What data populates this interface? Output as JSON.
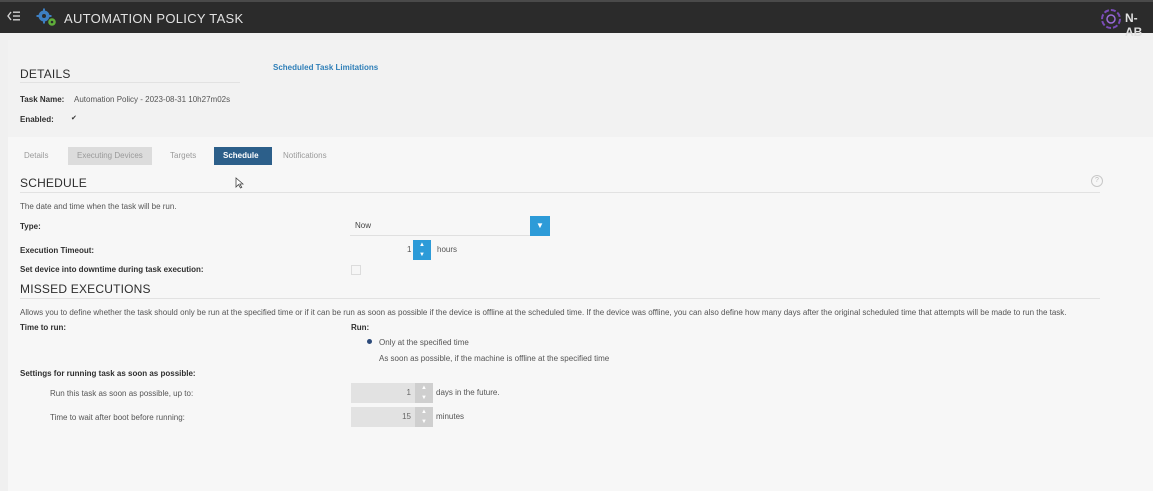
{
  "header": {
    "title": "AUTOMATION POLICY TASK",
    "brand": "N-AB",
    "menu_icon": "⋲"
  },
  "details": {
    "heading": "DETAILS",
    "limitations_link": "Scheduled Task Limitations",
    "task_name_label": "Task Name:",
    "task_name_value": "Automation Policy - 2023-08-31 10h27m02s",
    "enabled_label": "Enabled:",
    "enabled_check": "✔"
  },
  "tabs": [
    {
      "label": "Details"
    },
    {
      "label": "Executing Devices"
    },
    {
      "label": "Targets"
    },
    {
      "label": "Schedule"
    },
    {
      "label": "Notifications"
    }
  ],
  "schedule": {
    "heading": "SCHEDULE",
    "description": "The date and time when the task will be run.",
    "type_label": "Type:",
    "type_value": "Now",
    "timeout_label": "Execution Timeout:",
    "timeout_value": "1",
    "timeout_unit": "hours",
    "downtime_label": "Set device into downtime during task execution:"
  },
  "missed": {
    "heading": "MISSED EXECUTIONS",
    "description": "Allows you to define whether the task should only be run at the specified time or if it can be run as soon as possible if the device is offline at the scheduled time. If the device was offline, you can also define how many days after the original scheduled time that attempts will be made to run the task.",
    "time_to_run_label": "Time to run:",
    "run_label": "Run:",
    "option_specified": "Only at the specified time",
    "option_asap": "As soon as possible, if the machine is offline at the specified time",
    "settings_label": "Settings for running task as soon as possible:",
    "run_upto_label": "Run this task as soon as possible, up to:",
    "run_upto_value": "1",
    "run_upto_unit": "days in the future.",
    "wait_label": "Time to wait after boot before running:",
    "wait_value": "15",
    "wait_unit": "minutes"
  },
  "colors": {
    "topbar": "#2b2b2b",
    "active_tab": "#2c5f8a",
    "accent": "#2d9bd8",
    "link": "#2f7fb8"
  }
}
